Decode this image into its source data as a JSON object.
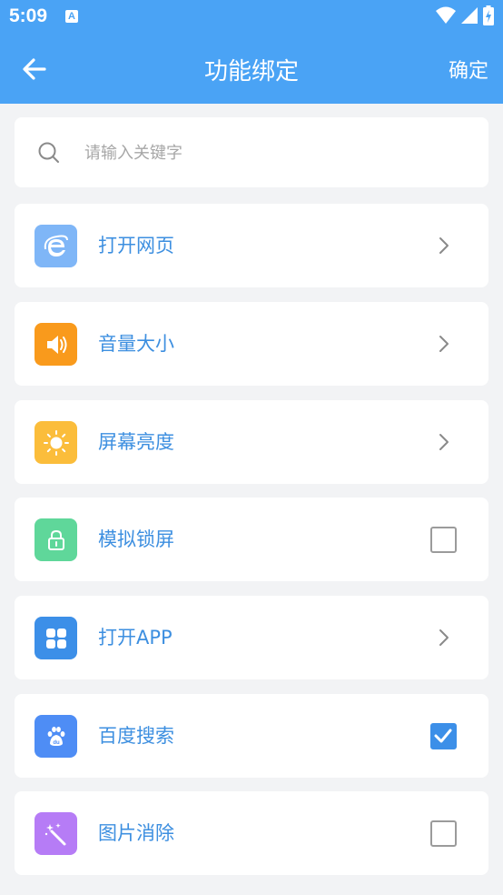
{
  "status_bar": {
    "time": "5:09",
    "app_badge": "A"
  },
  "header": {
    "title": "功能绑定",
    "confirm_label": "确定"
  },
  "search": {
    "placeholder": "请输入关键字",
    "value": ""
  },
  "items": [
    {
      "label": "打开网页",
      "icon": "ie-browser-icon",
      "color": "#7fb6f7",
      "control": "chevron"
    },
    {
      "label": "音量大小",
      "icon": "speaker-icon",
      "color": "#f99a1c",
      "control": "chevron"
    },
    {
      "label": "屏幕亮度",
      "icon": "sun-icon",
      "color": "#fbbd3b",
      "control": "chevron"
    },
    {
      "label": "模拟锁屏",
      "icon": "lock-icon",
      "color": "#5fd79a",
      "control": "checkbox",
      "checked": false
    },
    {
      "label": "打开APP",
      "icon": "apps-grid-icon",
      "color": "#3c8fe8",
      "control": "chevron"
    },
    {
      "label": "百度搜索",
      "icon": "baidu-paw-icon",
      "color": "#4e8df5",
      "control": "checkbox",
      "checked": true
    },
    {
      "label": "图片消除",
      "icon": "magic-wand-icon",
      "color": "#b67cf6",
      "control": "checkbox",
      "checked": false
    }
  ],
  "colors": {
    "primary": "#4aa3f5",
    "label_text": "#3d8fe0",
    "background": "#f2f3f5"
  }
}
